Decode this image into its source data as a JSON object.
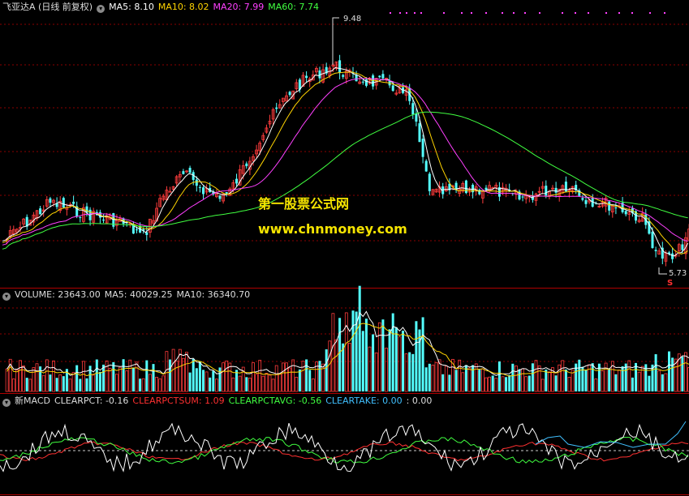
{
  "stock": {
    "title": "飞亚达A (日线 前复权)"
  },
  "ma_legend": [
    {
      "label": "MA5: 8.10",
      "color": "#ffffff"
    },
    {
      "label": "MA10: 8.02",
      "color": "#ffd400"
    },
    {
      "label": "MA20: 7.99",
      "color": "#ff40ff"
    },
    {
      "label": "MA60: 7.74",
      "color": "#40ff40"
    }
  ],
  "annotations": {
    "high": "9.48",
    "low": "5.73",
    "s_mark": "S"
  },
  "watermark": {
    "line1": "第一股票公式网",
    "line2": "www.chnmoney.com"
  },
  "volume_legend": [
    {
      "label": "VOLUME: 23643.00",
      "color": "#ffffff"
    },
    {
      "label": "MA5: 40029.25",
      "color": "#ffffff"
    },
    {
      "label": "MA10: 36340.70",
      "color": "#ffffff"
    }
  ],
  "indicator_legend": [
    {
      "label": "新MACD",
      "color": "#ffffff"
    },
    {
      "label": "CLEARPCT: -0.16",
      "color": "#ffffff"
    },
    {
      "label": "CLEARPCTSUM: 1.09",
      "color": "#ff3030"
    },
    {
      "label": "CLEARPCTAVG: -0.56",
      "color": "#40ff40"
    },
    {
      "label": "CLEARTAKE: 0.00",
      "color": "#40c0ff"
    },
    {
      "label": ": 0.00",
      "color": "#ffffff"
    }
  ],
  "colors": {
    "up": "#ff3c3c",
    "down": "#54ffff",
    "grid": "#8b0000",
    "divider": "#b00000",
    "ma5": "#ffffff",
    "ma10": "#ffd400",
    "ma20": "#ff40ff",
    "ma60": "#40ff40"
  }
}
